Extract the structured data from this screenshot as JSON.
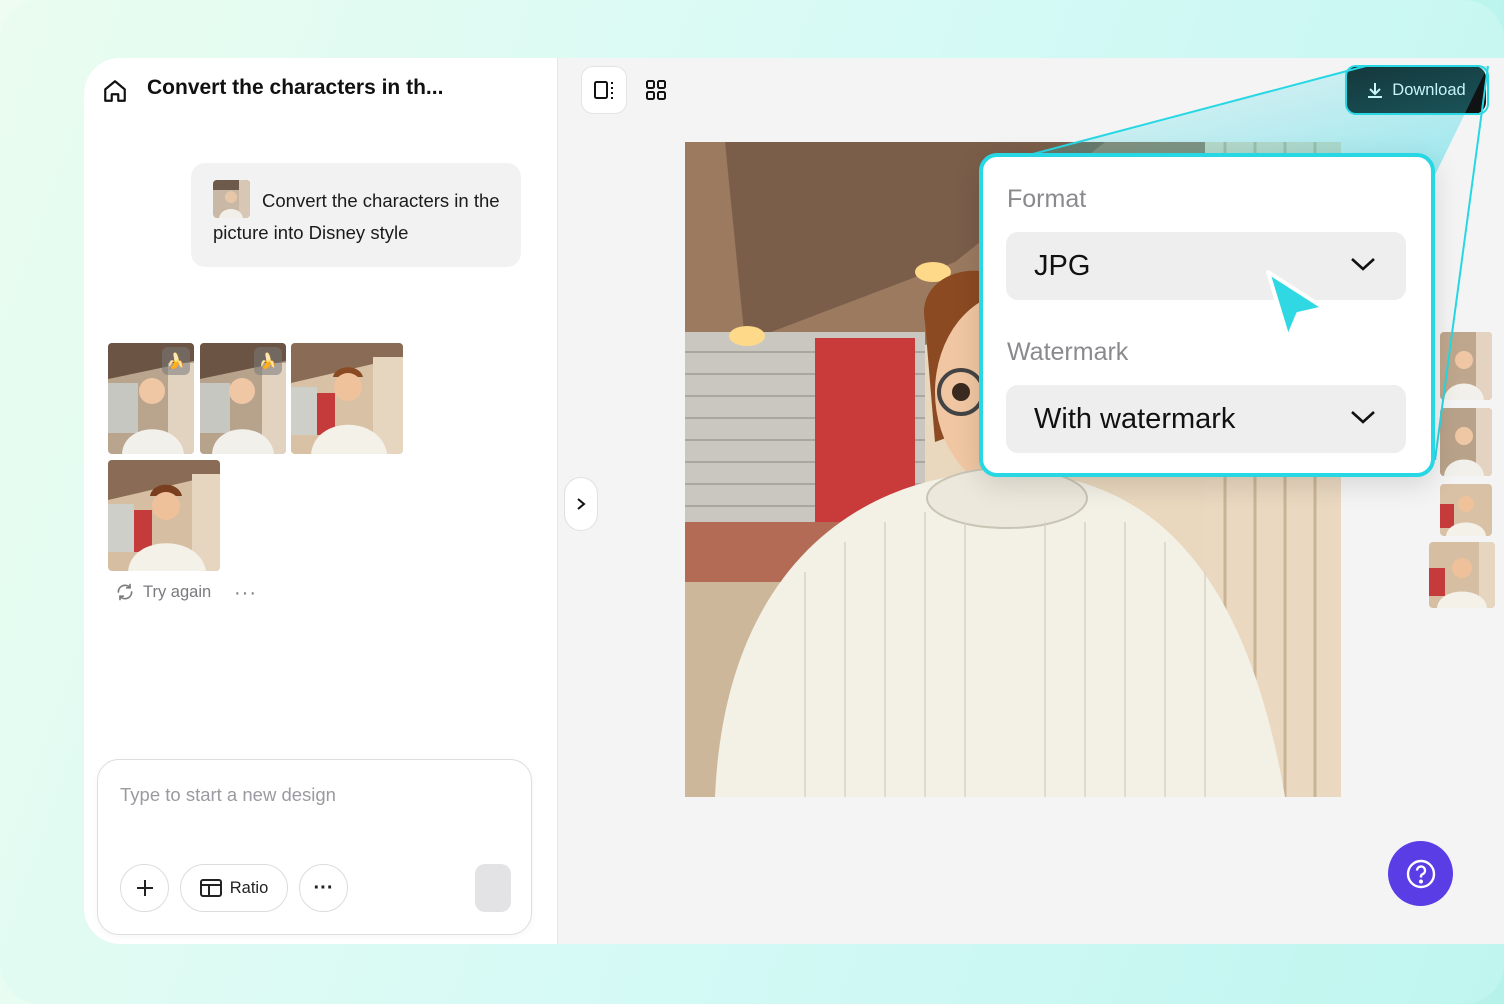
{
  "header": {
    "title": "Convert the characters in th..."
  },
  "chat": {
    "prompt_text": "Convert the characters in the picture into Disney style",
    "try_again_label": "Try again",
    "more_label": "···"
  },
  "composer": {
    "placeholder": "Type to start a new design",
    "ratio_label": "Ratio",
    "more_label": "···"
  },
  "toolbar": {
    "download_label": "Download"
  },
  "export_popup": {
    "format_label": "Format",
    "format_value": "JPG",
    "watermark_label": "Watermark",
    "watermark_value": "With watermark"
  },
  "colors": {
    "accent_cyan": "#27d7e3",
    "help_purple": "#5b3de6",
    "download_black": "#111214"
  },
  "icons": [
    "home-icon",
    "panel-view-icon",
    "grid-view-icon",
    "download-icon",
    "chevron-right-icon",
    "chevron-down-icon",
    "refresh-icon",
    "plus-icon",
    "ratio-icon",
    "more-icon",
    "help-icon",
    "banana-icon",
    "cursor-pointer-icon"
  ]
}
